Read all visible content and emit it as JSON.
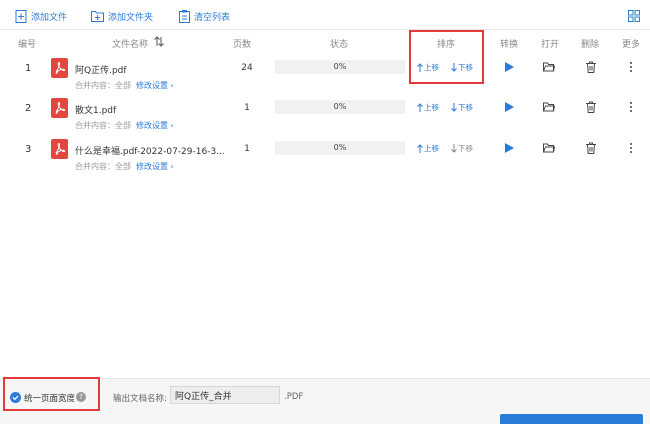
{
  "toolbar": {
    "add_file": "添加文件",
    "add_folder": "添加文件夹",
    "clear_list": "清空列表"
  },
  "columns": {
    "number": "编号",
    "filename": "文件名称",
    "pages": "页数",
    "status": "状态",
    "sort": "排序",
    "convert": "转换",
    "open": "打开",
    "delete": "删除",
    "more": "更多"
  },
  "rows": [
    {
      "number": "1",
      "filename": "阿Q正传.pdf",
      "merge_label": "合并内容：全部",
      "modify": "修改设置",
      "pages": "24",
      "progress": "0%",
      "progress_value": 0,
      "move_up": "上移",
      "move_down": "下移",
      "up_enabled": true,
      "down_enabled": true
    },
    {
      "number": "2",
      "filename": "散文1.pdf",
      "merge_label": "合并内容：全部",
      "modify": "修改设置",
      "pages": "1",
      "progress": "0%",
      "progress_value": 0,
      "move_up": "上移",
      "move_down": "下移",
      "up_enabled": true,
      "down_enabled": true
    },
    {
      "number": "3",
      "filename": "什么是幸福.pdf-2022-07-29-16-3...",
      "merge_label": "合并内容：全部",
      "modify": "修改设置",
      "pages": "1",
      "progress": "0%",
      "progress_value": 0,
      "move_up": "上移",
      "move_down": "下移",
      "up_enabled": true,
      "down_enabled": false
    }
  ],
  "footer": {
    "unify_width": "统一页面宽度",
    "unify_checked": true,
    "output_label": "输出文档名称:",
    "output_value": "阿Q正传_合并",
    "extension": ".PDF"
  },
  "colors": {
    "accent": "#2b7bd8",
    "pdf_red": "#e2463f",
    "highlight": "#e23b3b"
  },
  "icons": [
    "add-file-icon",
    "add-folder-icon",
    "clear-list-icon",
    "grid-view-icon",
    "sort-icon",
    "pdf-file-icon",
    "play-icon",
    "folder-open-icon",
    "trash-icon",
    "more-vertical-icon",
    "help-icon",
    "checkbox-icon"
  ]
}
